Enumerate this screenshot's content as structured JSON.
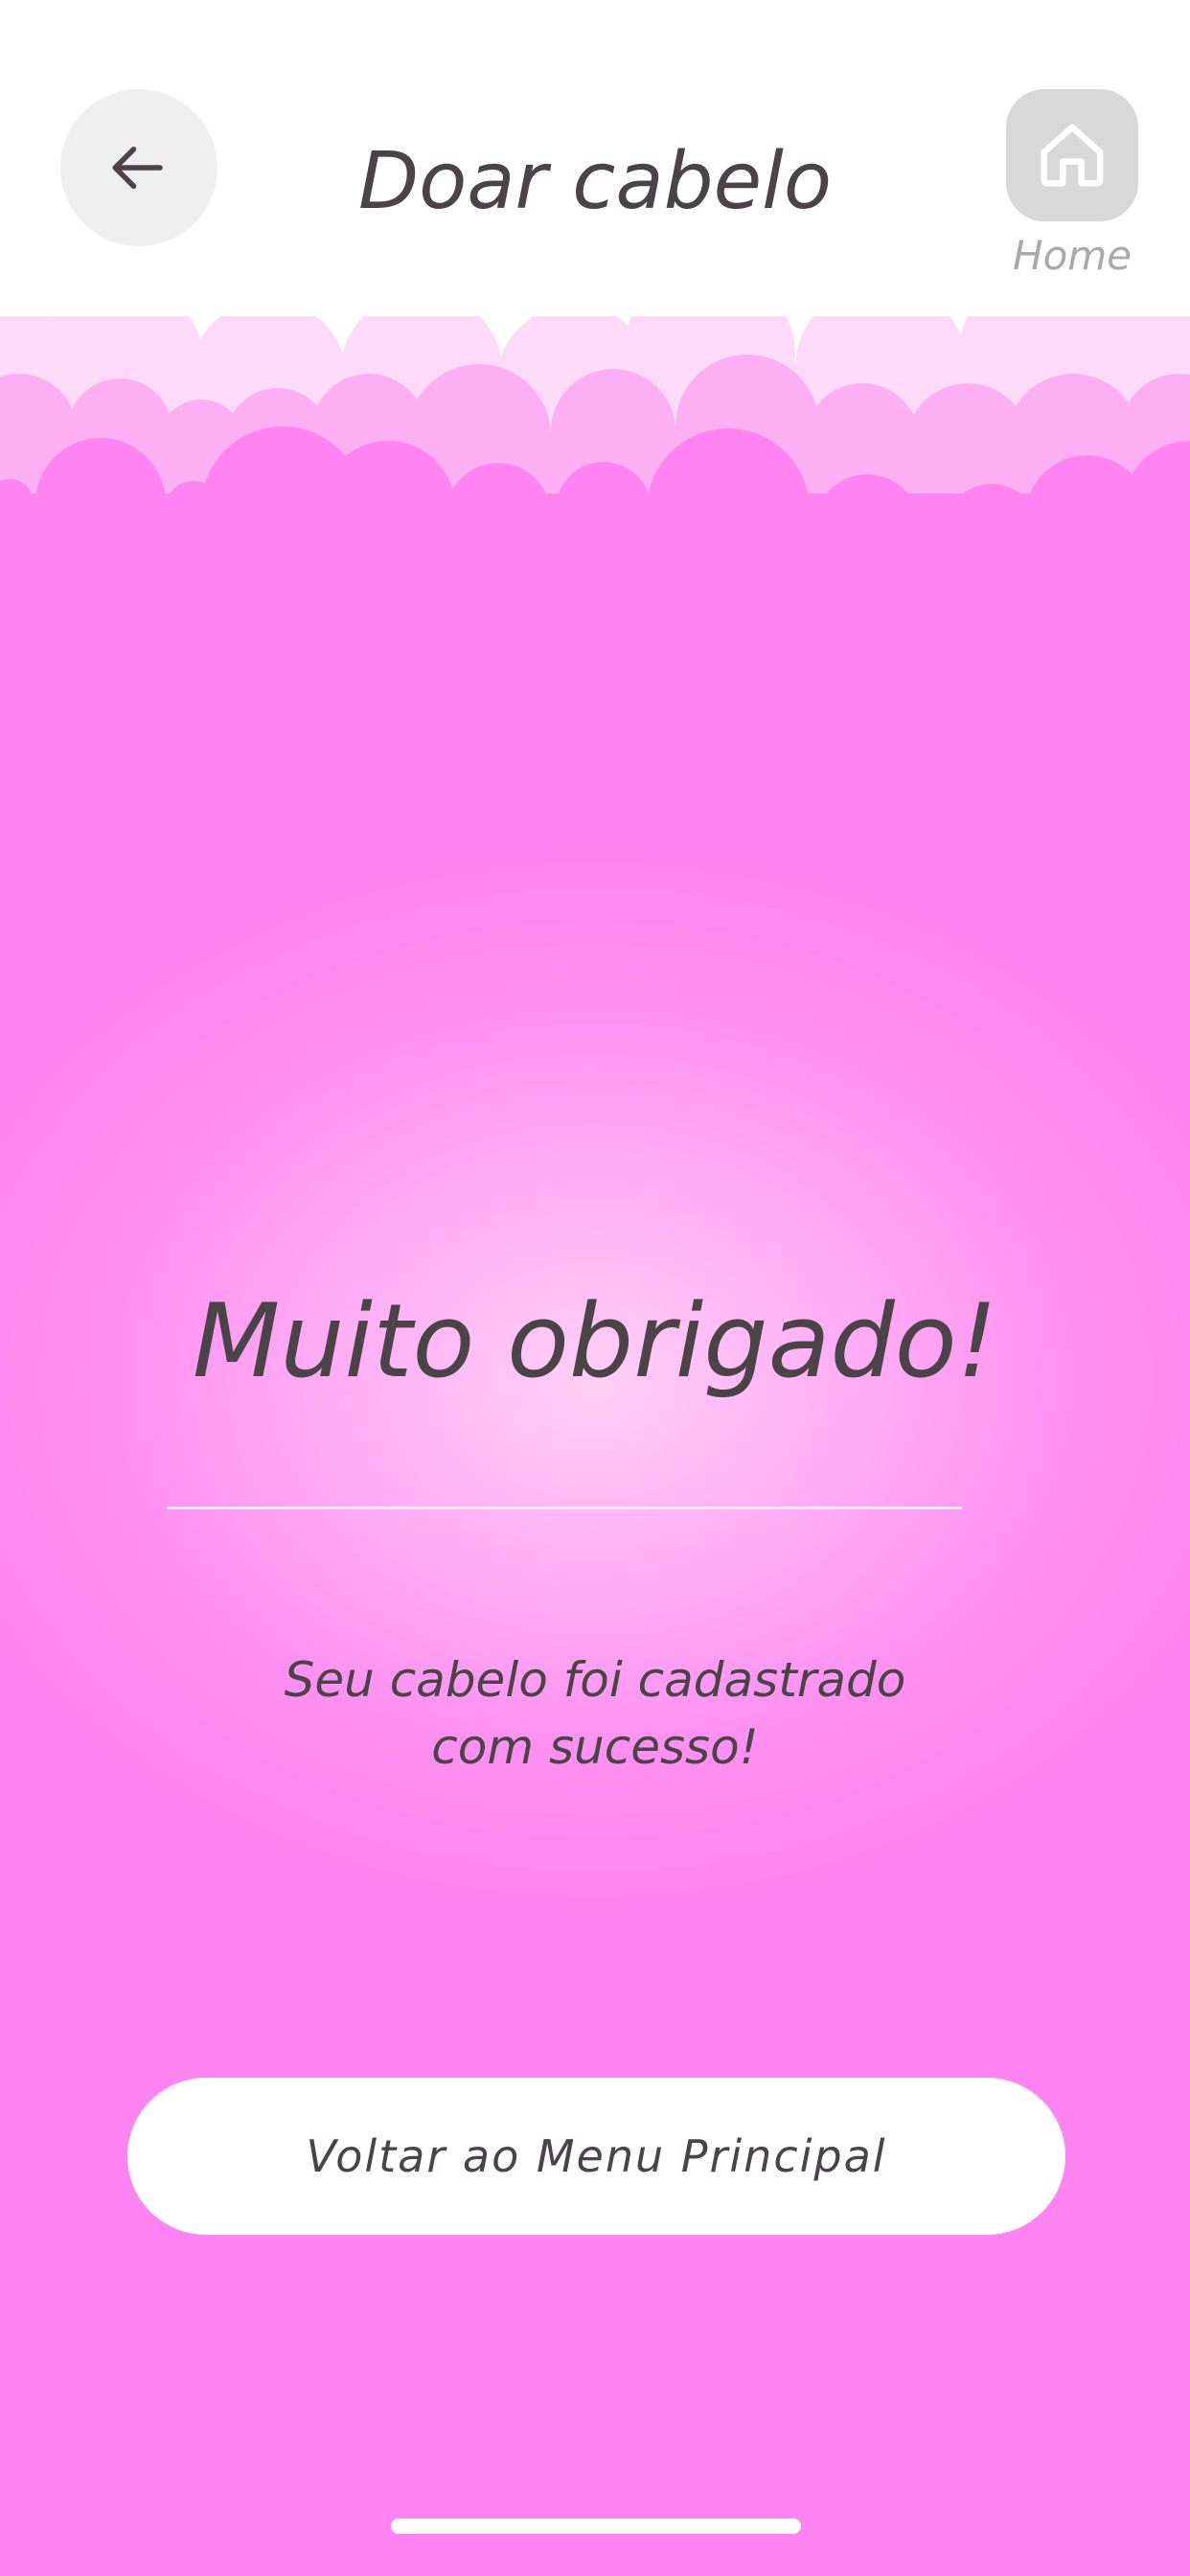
{
  "header": {
    "title": "Doar cabelo",
    "back_icon": "arrow-left-icon",
    "home_icon": "home-icon",
    "home_label": "Home"
  },
  "content": {
    "heading": "Muito obrigado!",
    "message_line1": "Seu cabelo foi cadastrado",
    "message_line2": "com sucesso!"
  },
  "actions": {
    "main_menu_label": "Voltar ao Menu Principal"
  },
  "colors": {
    "background_pink": "#ff83f0",
    "glow_pink": "#ffcff6",
    "cloud_light": "#fddaf8",
    "cloud_mid": "#fcb0f3",
    "text_dark": "#4a4448",
    "button_gray": "#efefef",
    "home_gray": "#d8d8d8"
  }
}
